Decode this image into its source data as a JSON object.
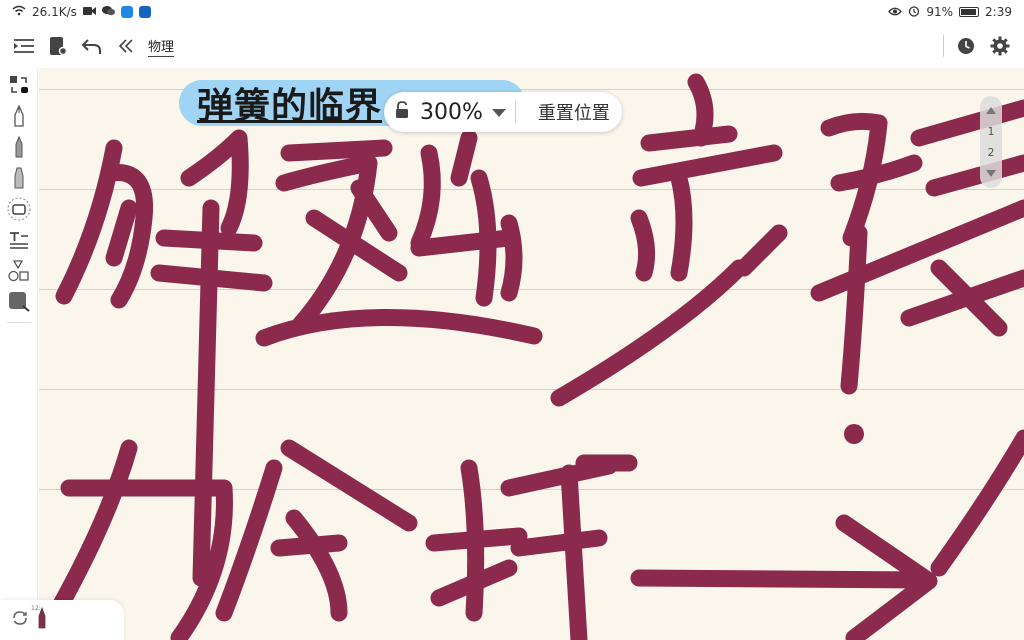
{
  "status_bar": {
    "network_speed": "26.1K/s",
    "battery_percent": "91%",
    "battery_level": 0.91,
    "time": "2:39",
    "app_badge_colors": [
      "#1e88e5",
      "#1565c0"
    ]
  },
  "toolbar": {
    "notebook_title": "物理",
    "icons": [
      "outline-toggle-icon",
      "notebook-icon",
      "undo-icon",
      "collapse-icon",
      "history-icon",
      "settings-icon"
    ]
  },
  "left_rail": {
    "tools": [
      "lasso-select-icon",
      "fountain-pen-icon",
      "ballpoint-pen-icon",
      "highlighter-icon",
      "eraser-icon",
      "text-icon",
      "shapes-icon",
      "image-icon"
    ]
  },
  "canvas": {
    "title": "弹簧的临界",
    "title_chip_color": "#9fd4f5",
    "ink_color": "#8b2a4d",
    "paper_color": "#faf6ec"
  },
  "zoom_popup": {
    "zoom": "300%",
    "reset_label": "重置位置"
  },
  "page_scroller": {
    "pages": [
      "1",
      "2"
    ]
  },
  "sync_card": {
    "time_text": "12:"
  }
}
